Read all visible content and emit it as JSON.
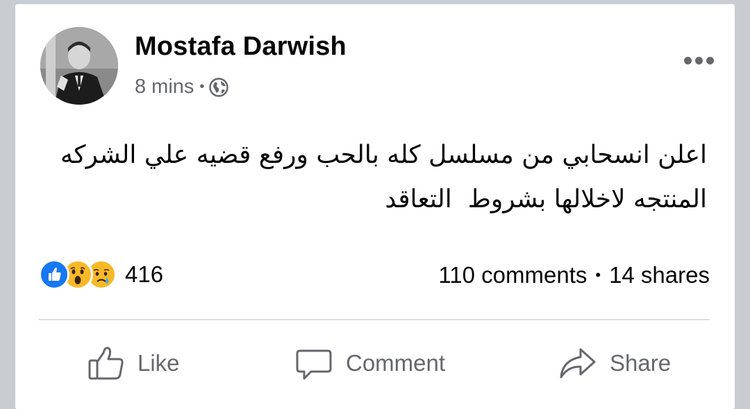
{
  "post": {
    "author": "Mostafa Darwish",
    "time": "8 mins",
    "meta_separator": "•",
    "privacy_icon": "globe-icon",
    "text": "اعلن انسحابي من مسلسل كله بالحب ورفع قضيه علي الشركه\nالمنتجه لاخلالها بشروط  التعاقد"
  },
  "stats": {
    "reactions": [
      "like-reaction-icon",
      "wow-reaction-icon",
      "sad-reaction-icon"
    ],
    "reaction_count": "416",
    "comments": "110 comments",
    "separator": "•",
    "shares": "14 shares"
  },
  "actions": {
    "like": "Like",
    "comment": "Comment",
    "share": "Share"
  },
  "colors": {
    "like_blue": "#1877f2",
    "reaction_yellow": "#f7b928",
    "secondary_text": "#65676b",
    "background": "#c9ccd1"
  }
}
